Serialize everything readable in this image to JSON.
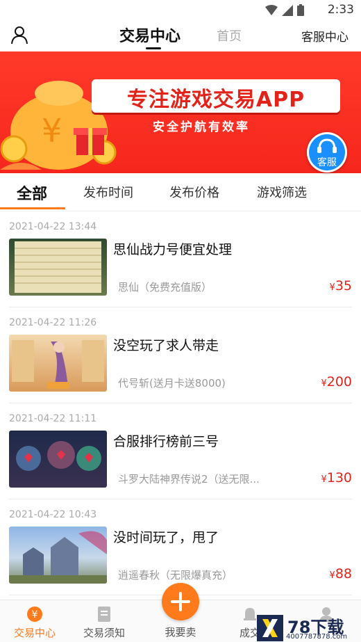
{
  "status": {
    "time": "2:33"
  },
  "header": {
    "tab_main": "交易中心",
    "tab_home": "首页",
    "customer_service": "客服中心"
  },
  "banner": {
    "title": "专注游戏交易APP",
    "subtitle": "安全护航有效率",
    "cs_button": "客服"
  },
  "filters": [
    "全部",
    "发布时间",
    "发布价格",
    "游戏筛选"
  ],
  "items": [
    {
      "date": "2021-04-22 13:44",
      "name": "思仙战力号便宜处理",
      "game": "思仙（免费充值版）",
      "currency": "¥",
      "price": "35"
    },
    {
      "date": "2021-04-22 11:26",
      "name": "没空玩了求人带走",
      "game": "代号斩(送月卡送8000)",
      "currency": "¥",
      "price": "200"
    },
    {
      "date": "2021-04-22 11:11",
      "name": "合服排行榜前三号",
      "game": "斗罗大陆神界传说2（送无限...",
      "currency": "¥",
      "price": "130"
    },
    {
      "date": "2021-04-22 10:43",
      "name": "没时间玩了，甩了",
      "game": "逍遥春秋（无限爆真充）",
      "currency": "¥",
      "price": "88"
    }
  ],
  "bottom_nav": {
    "trade_center": "交易中心",
    "trade_notice": "交易须知",
    "sell": "我要卖",
    "deal": "成交"
  },
  "watermark": {
    "big": "78下载",
    "small": "4007787878.com"
  },
  "colors": {
    "accent": "#ff7a1a",
    "banner_red": "#f6261c",
    "price_red": "#e2231a",
    "cs_blue": "#1a8fff"
  }
}
